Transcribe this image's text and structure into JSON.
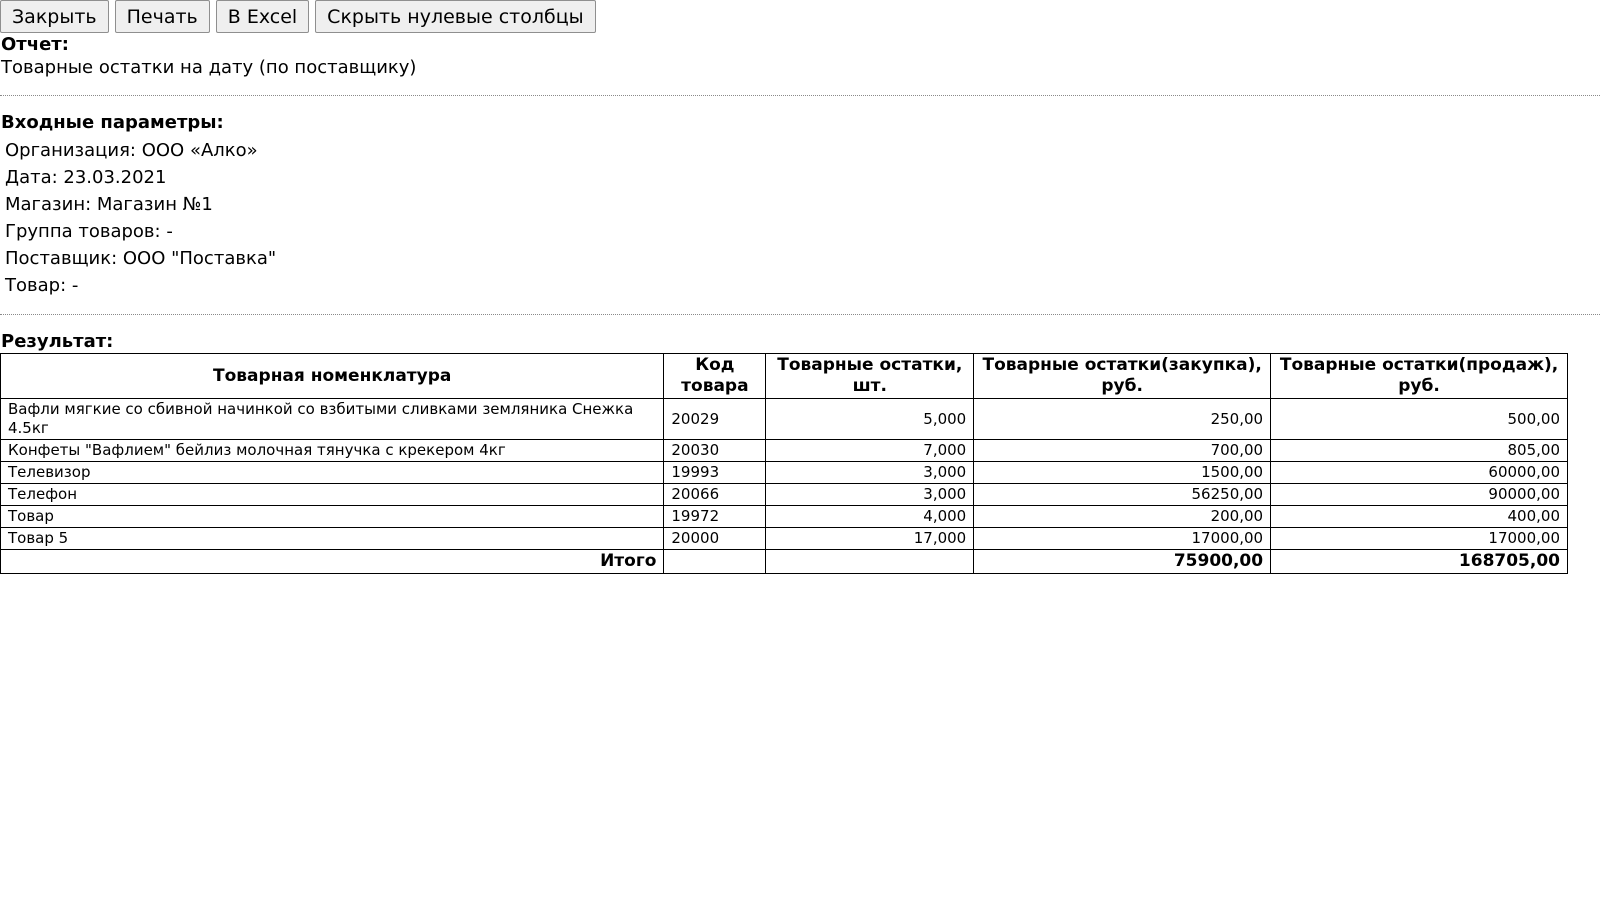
{
  "toolbar": {
    "close_label": "Закрыть",
    "print_label": "Печать",
    "excel_label": "В Excel",
    "hide_zero_label": "Скрыть нулевые столбцы"
  },
  "report": {
    "heading": "Отчет:",
    "name": "Товарные остатки на дату (по поставщику)"
  },
  "params": {
    "heading": "Входные параметры:",
    "items": [
      "Организация: ООО «Алко»",
      "Дата: 23.03.2021",
      "Магазин: Магазин №1",
      "Группа товаров: -",
      "Поставщик: ООО \"Поставка\"",
      "Товар: -"
    ]
  },
  "result": {
    "heading": "Результат:",
    "columns": [
      "Товарная номенклатура",
      "Код товара",
      "Товарные остатки, шт.",
      "Товарные остатки(закупка), руб.",
      "Товарные остатки(продаж), руб."
    ],
    "rows": [
      [
        "Вафли мягкие со сбивной начинкой со взбитыми сливками земляника Снежка 4.5кг",
        "20029",
        "5,000",
        "250,00",
        "500,00"
      ],
      [
        "Конфеты \"Вафлием\" бейлиз молочная тянучка с крекером 4кг",
        "20030",
        "7,000",
        "700,00",
        "805,00"
      ],
      [
        "Телевизор",
        "19993",
        "3,000",
        "1500,00",
        "60000,00"
      ],
      [
        "Телефон",
        "20066",
        "3,000",
        "56250,00",
        "90000,00"
      ],
      [
        "Товар",
        "19972",
        "4,000",
        "200,00",
        "400,00"
      ],
      [
        "Товар 5",
        "20000",
        "17,000",
        "17000,00",
        "17000,00"
      ]
    ],
    "total": {
      "label": "Итого",
      "code": "",
      "qty": "",
      "purchase": "75900,00",
      "sale": "168705,00"
    }
  }
}
